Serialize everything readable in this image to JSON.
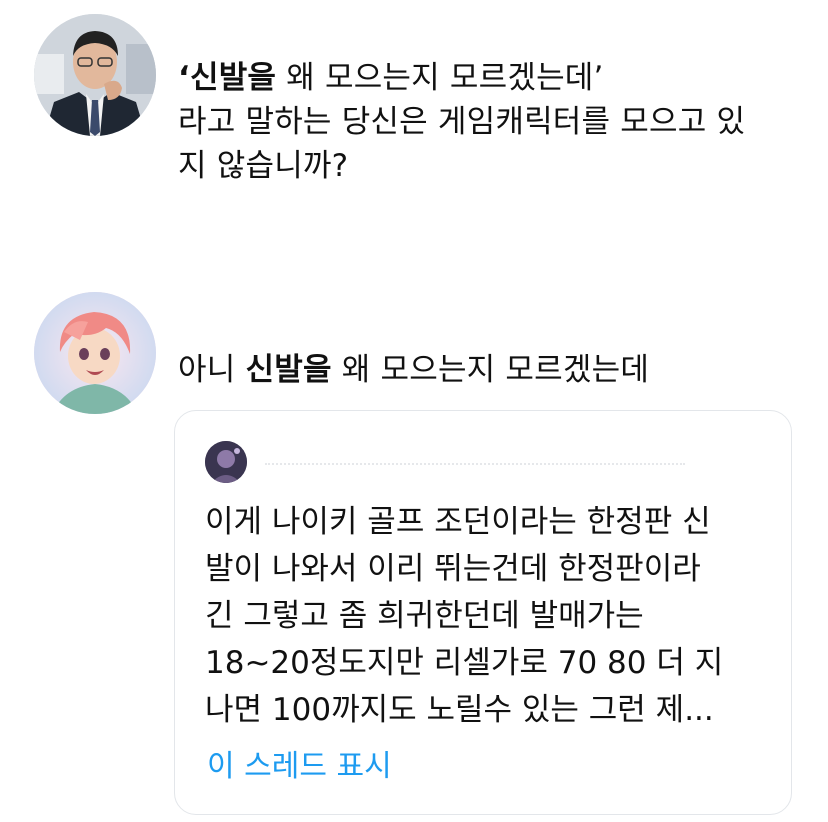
{
  "tweet_top": {
    "quote_open": "‘",
    "bold": "신발을",
    "rest_line1": " 왜 모으는지 모르겠는데’",
    "line2": "라고 말하는 당신은 게임캐릭터를 모으고 있",
    "line3": "지 않습니까?"
  },
  "tweet_mid": {
    "prefix": "아니 ",
    "bold": "신발을",
    "suffix": " 왜 모으는지 모르겠는데"
  },
  "quoted": {
    "lines": [
      "이게 나이키 골프 조던이라는 한정판 신",
      "발이 나와서 이리 뛰는건데 한정판이라",
      "긴 그렇고 좀 희귀한던데 발매가는",
      "18~20정도지만 리셀가로 70 80 더 지",
      "나면 100까지도 노릴수 있는 그런 제..."
    ],
    "show_thread": "이 스레드 표시"
  },
  "colors": {
    "link": "#1d9bf0",
    "text": "#111111",
    "card_border": "#e3e6ea"
  },
  "icons": {
    "avatar_top": "man-in-suit-avatar",
    "avatar_mid": "anime-character-avatar",
    "quote_avatar": "user-avatar"
  }
}
